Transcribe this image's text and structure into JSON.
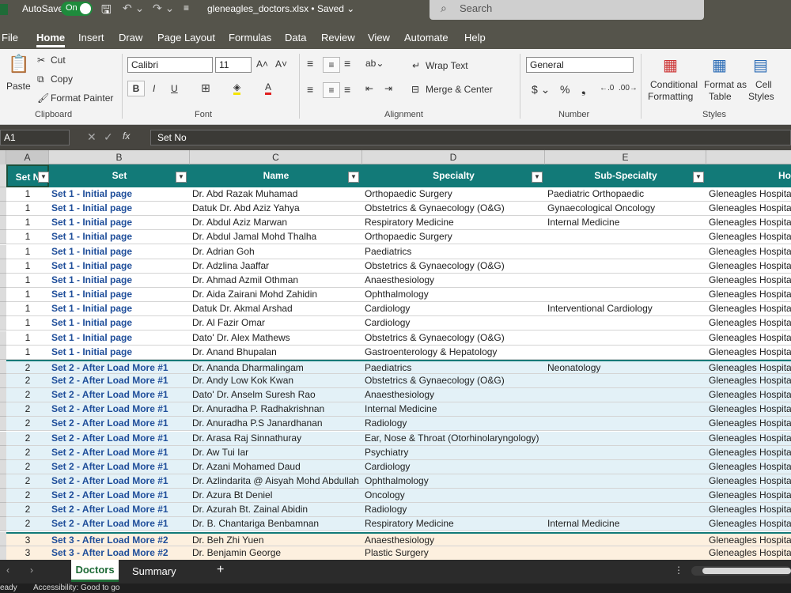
{
  "titlebar": {
    "autosave_label": "AutoSave",
    "autosave_state": "On",
    "filename": "gleneagles_doctors.xlsx • Saved ⌄",
    "search_placeholder": "Search"
  },
  "menu": [
    "File",
    "Home",
    "Insert",
    "Draw",
    "Page Layout",
    "Formulas",
    "Data",
    "Review",
    "View",
    "Automate",
    "Help"
  ],
  "ribbon": {
    "clipboard": {
      "paste": "Paste",
      "cut": "Cut",
      "copy": "Copy",
      "format_painter": "Format Painter",
      "group": "Clipboard"
    },
    "font": {
      "name": "Calibri",
      "size": "11",
      "group": "Font"
    },
    "alignment": {
      "wrap": "Wrap Text",
      "merge": "Merge & Center",
      "group": "Alignment"
    },
    "number": {
      "format": "General",
      "group": "Number"
    },
    "styles": {
      "conditional": "Conditional",
      "conditional2": "Formatting",
      "format_table": "Format as",
      "format_table2": "Table",
      "cell_styles": "Cell",
      "cell_styles2": "Styles",
      "group": "Styles"
    }
  },
  "formula": {
    "namebox": "A1",
    "content": "Set No"
  },
  "columns": [
    "A",
    "B",
    "C",
    "D",
    "E"
  ],
  "headers": {
    "setno": "Set N",
    "set": "Set",
    "name": "Name",
    "specialty": "Specialty",
    "subspecialty": "Sub-Specialty",
    "hospital": "Ho"
  },
  "rows": [
    {
      "n": "1",
      "set": "Set 1 - Initial page",
      "name": "Dr. Abd Razak Muhamad",
      "spec": "Orthopaedic Surgery",
      "sub": "Paediatric Orthopaedic",
      "hosp": "Gleneagles Hospita"
    },
    {
      "n": "1",
      "set": "Set 1 - Initial page",
      "name": "Datuk Dr. Abd Aziz Yahya",
      "spec": "Obstetrics & Gynaecology (O&G)",
      "sub": "Gynaecological Oncology",
      "hosp": "Gleneagles Hospita"
    },
    {
      "n": "1",
      "set": "Set 1 - Initial page",
      "name": "Dr. Abdul Aziz Marwan",
      "spec": "Respiratory Medicine",
      "sub": "Internal Medicine",
      "hosp": "Gleneagles Hospita"
    },
    {
      "n": "1",
      "set": "Set 1 - Initial page",
      "name": "Dr. Abdul Jamal Mohd Thalha",
      "spec": "Orthopaedic Surgery",
      "sub": "",
      "hosp": "Gleneagles Hospita"
    },
    {
      "n": "1",
      "set": "Set 1 - Initial page",
      "name": "Dr. Adrian Goh",
      "spec": "Paediatrics",
      "sub": "",
      "hosp": "Gleneagles Hospita"
    },
    {
      "n": "1",
      "set": "Set 1 - Initial page",
      "name": "Dr. Adzlina Jaaffar",
      "spec": "Obstetrics & Gynaecology (O&G)",
      "sub": "",
      "hosp": "Gleneagles Hospita"
    },
    {
      "n": "1",
      "set": "Set 1 - Initial page",
      "name": "Dr. Ahmad Azmil Othman",
      "spec": "Anaesthesiology",
      "sub": "",
      "hosp": "Gleneagles Hospita"
    },
    {
      "n": "1",
      "set": "Set 1 - Initial page",
      "name": "Dr. Aida Zairani Mohd Zahidin",
      "spec": "Ophthalmology",
      "sub": "",
      "hosp": "Gleneagles Hospita"
    },
    {
      "n": "1",
      "set": "Set 1 - Initial page",
      "name": "Datuk Dr. Akmal Arshad",
      "spec": "Cardiology",
      "sub": "Interventional Cardiology",
      "hosp": "Gleneagles Hospita"
    },
    {
      "n": "1",
      "set": "Set 1 - Initial page",
      "name": "Dr. Al Fazir Omar",
      "spec": "Cardiology",
      "sub": "",
      "hosp": "Gleneagles Hospita"
    },
    {
      "n": "1",
      "set": "Set 1 - Initial page",
      "name": "Dato' Dr. Alex Mathews",
      "spec": "Obstetrics & Gynaecology (O&G)",
      "sub": "",
      "hosp": "Gleneagles Hospita"
    },
    {
      "n": "1",
      "set": "Set 1 - Initial page",
      "name": "Dr. Anand Bhupalan",
      "spec": "Gastroenterology & Hepatology",
      "sub": "",
      "hosp": "Gleneagles Hospita"
    },
    {
      "n": "2",
      "set": "Set 2 - After Load More #1",
      "name": "Dr. Ananda Dharmalingam",
      "spec": "Paediatrics",
      "sub": "Neonatology",
      "hosp": "Gleneagles Hospita"
    },
    {
      "n": "2",
      "set": "Set 2 - After Load More #1",
      "name": "Dr. Andy Low Kok Kwan",
      "spec": "Obstetrics & Gynaecology (O&G)",
      "sub": "",
      "hosp": "Gleneagles Hospita"
    },
    {
      "n": "2",
      "set": "Set 2 - After Load More #1",
      "name": "Dato' Dr. Anselm Suresh Rao",
      "spec": "Anaesthesiology",
      "sub": "",
      "hosp": "Gleneagles Hospita"
    },
    {
      "n": "2",
      "set": "Set 2 - After Load More #1",
      "name": "Dr. Anuradha P. Radhakrishnan",
      "spec": "Internal Medicine",
      "sub": "",
      "hosp": "Gleneagles Hospita"
    },
    {
      "n": "2",
      "set": "Set 2 - After Load More #1",
      "name": "Dr. Anuradha P.S Janardhanan",
      "spec": "Radiology",
      "sub": "",
      "hosp": "Gleneagles Hospita"
    },
    {
      "n": "2",
      "set": "Set 2 - After Load More #1",
      "name": "Dr. Arasa Raj Sinnathuray",
      "spec": "Ear, Nose & Throat (Otorhinolaryngology)",
      "sub": "",
      "hosp": "Gleneagles Hospita"
    },
    {
      "n": "2",
      "set": "Set 2 - After Load More #1",
      "name": "Dr. Aw Tui Iar",
      "spec": "Psychiatry",
      "sub": "",
      "hosp": "Gleneagles Hospita"
    },
    {
      "n": "2",
      "set": "Set 2 - After Load More #1",
      "name": "Dr. Azani Mohamed Daud",
      "spec": "Cardiology",
      "sub": "",
      "hosp": "Gleneagles Hospita"
    },
    {
      "n": "2",
      "set": "Set 2 - After Load More #1",
      "name": "Dr. Azlindarita @ Aisyah Mohd Abdullah",
      "spec": "Ophthalmology",
      "sub": "",
      "hosp": "Gleneagles Hospita"
    },
    {
      "n": "2",
      "set": "Set 2 - After Load More #1",
      "name": "Dr. Azura Bt Deniel",
      "spec": "Oncology",
      "sub": "",
      "hosp": "Gleneagles Hospita"
    },
    {
      "n": "2",
      "set": "Set 2 - After Load More #1",
      "name": "Dr. Azurah Bt. Zainal Abidin",
      "spec": "Radiology",
      "sub": "",
      "hosp": "Gleneagles Hospita"
    },
    {
      "n": "2",
      "set": "Set 2 - After Load More #1",
      "name": "Dr. B. Chantariga Benbamnan",
      "spec": "Respiratory Medicine",
      "sub": "Internal Medicine",
      "hosp": "Gleneagles Hospita"
    },
    {
      "n": "3",
      "set": "Set 3 - After Load More #2",
      "name": "Dr. Beh Zhi Yuen",
      "spec": "Anaesthesiology",
      "sub": "",
      "hosp": "Gleneagles Hospita"
    },
    {
      "n": "3",
      "set": "Set 3 - After Load More #2",
      "name": "Dr. Benjamin George",
      "spec": "Plastic Surgery",
      "sub": "",
      "hosp": "Gleneagles Hospita"
    }
  ],
  "sheets": {
    "tab1": "Doctors",
    "tab2": "Summary",
    "add": "+"
  },
  "status": {
    "ready": "eady",
    "accessibility": "Accessibility: Good to go"
  },
  "colors": {
    "header": "#127a78",
    "set1": "#ffffff",
    "set2": "#e3f1f7",
    "set3": "#fdf0df"
  }
}
